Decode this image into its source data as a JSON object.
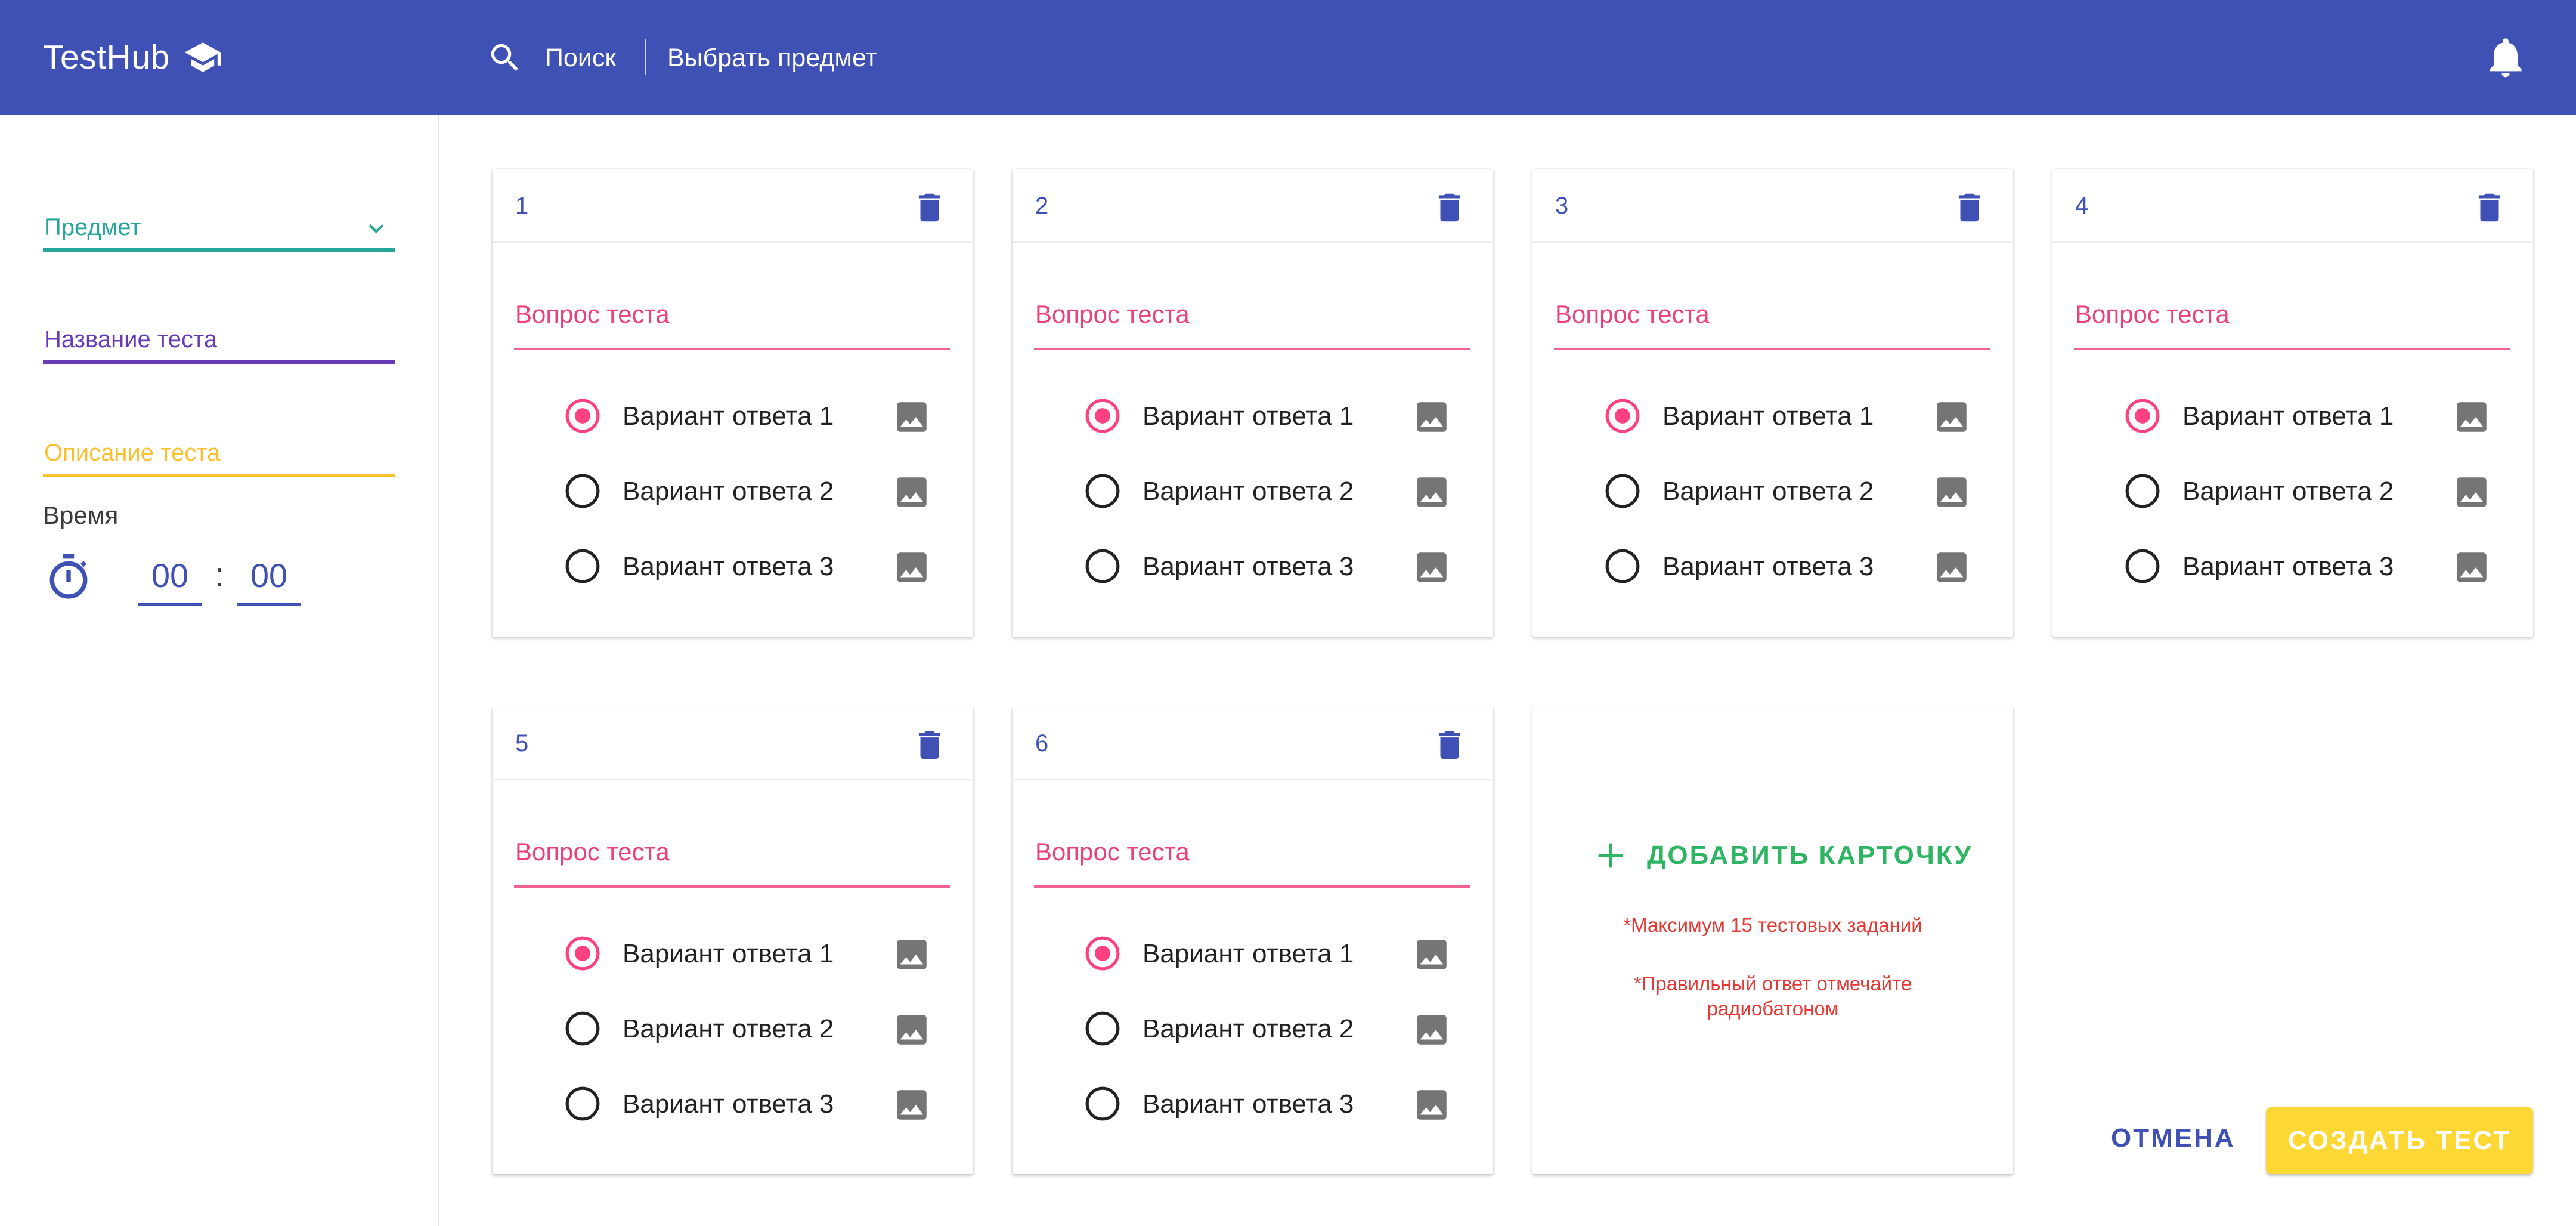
{
  "header": {
    "brand": "TestHub",
    "search_label": "Поиск",
    "subject_link": "Выбрать предмет",
    "bg_color": "#3F51B5"
  },
  "sidebar": {
    "subject_label": "Предмет",
    "test_name_label": "Название теста",
    "test_desc_label": "Описание теста",
    "time_label": "Время",
    "hours": "00",
    "minutes": "00",
    "colon": ":",
    "colors": {
      "subject": "#26A69A",
      "name": "#673AB7",
      "desc": "#FBC02D"
    }
  },
  "cards": [
    {
      "number": "1",
      "question": "Вопрос теста",
      "options": [
        "Вариант ответа 1",
        "Вариант ответа 2",
        "Вариант ответа 3"
      ],
      "selected": 0
    },
    {
      "number": "2",
      "question": "Вопрос теста",
      "options": [
        "Вариант ответа 1",
        "Вариант ответа 2",
        "Вариант ответа 3"
      ],
      "selected": 0
    },
    {
      "number": "3",
      "question": "Вопрос теста",
      "options": [
        "Вариант ответа 1",
        "Вариант ответа 2",
        "Вариант ответа 3"
      ],
      "selected": 0
    },
    {
      "number": "4",
      "question": "Вопрос теста",
      "options": [
        "Вариант ответа 1",
        "Вариант ответа 2",
        "Вариант ответа 3"
      ],
      "selected": 0
    },
    {
      "number": "5",
      "question": "Вопрос теста",
      "options": [
        "Вариант ответа 1",
        "Вариант ответа 2",
        "Вариант ответа 3"
      ],
      "selected": 0
    },
    {
      "number": "6",
      "question": "Вопрос теста",
      "options": [
        "Вариант ответа 1",
        "Вариант ответа 2",
        "Вариант ответа 3"
      ],
      "selected": 0
    }
  ],
  "add_card": {
    "label": "ДОБАВИТЬ КАРТОЧКУ",
    "note_max": "*Максимум 15 тестовых заданий",
    "note_radio": "*Правильный ответ отмечайте радиобатоном"
  },
  "actions": {
    "cancel": "ОТМЕНА",
    "create": "СОЗДАТЬ ТЕСТ"
  },
  "icons": {
    "brand": "graduation-cap-icon",
    "search": "search-icon",
    "notifications": "bell-icon",
    "dropdown": "chevron-down-icon",
    "timer": "stopwatch-icon",
    "delete": "trash-icon",
    "image": "image-icon",
    "add": "plus-icon"
  },
  "colors": {
    "primary": "#3F51B5",
    "question": "#EC407A",
    "radio_selected": "#FF4081",
    "add": "#2EB564",
    "note": "#E53935",
    "create_button": "#FDD835"
  }
}
